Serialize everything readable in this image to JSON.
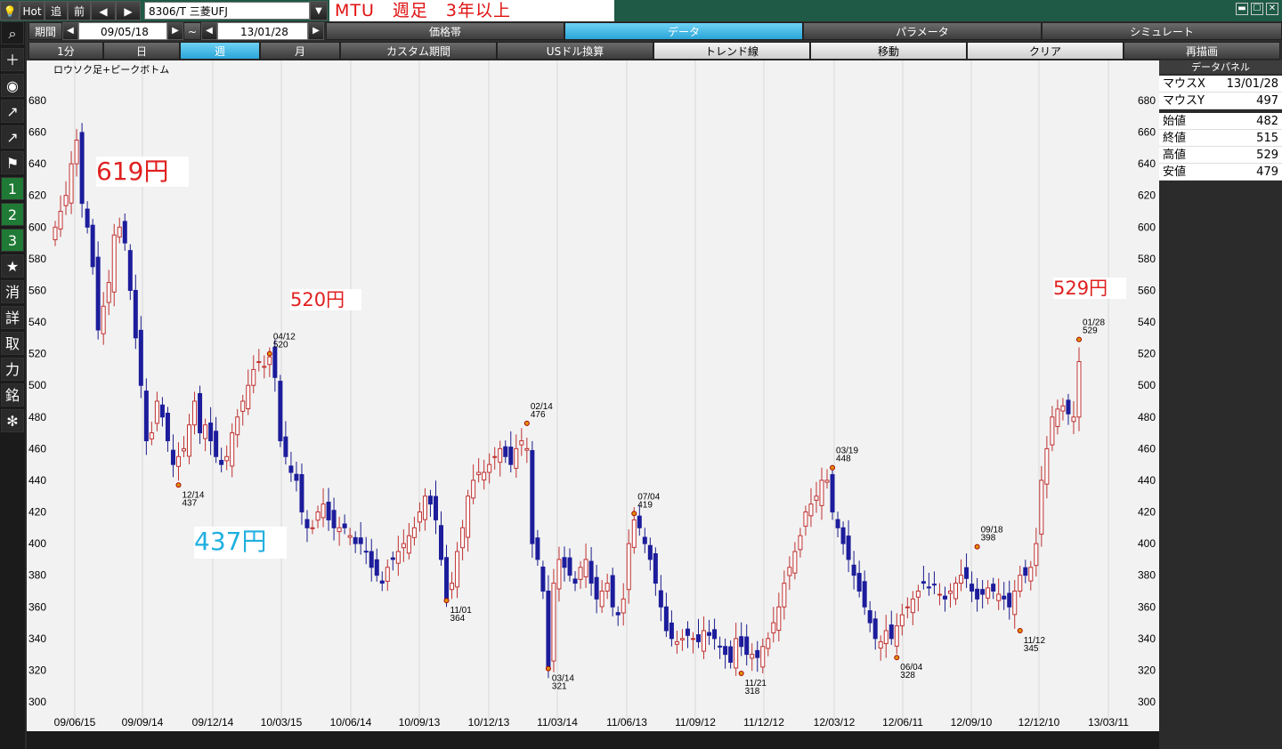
{
  "toolbar": {
    "hot": "Hot",
    "next": "追",
    "prev": "前",
    "arrow_left": "◀",
    "arrow_right": "▶",
    "symbol": "8306/T 三菱UFJ",
    "dropdown": "▼",
    "title": "MTU　週足　3年以上",
    "win_min": "▬",
    "win_max": "☐",
    "win_close": "✕"
  },
  "period": {
    "label": "期間",
    "from": "09/05/18",
    "tilde": "~",
    "to": "13/01/28"
  },
  "tabs_row1": [
    "価格帯",
    "データ",
    "パラメータ",
    "シミュレート"
  ],
  "tabs_row2": [
    "1分",
    "日",
    "週",
    "月",
    "カスタム期間",
    "USドル換算",
    "トレンド線",
    "移動",
    "クリア",
    "再描画"
  ],
  "sidebar": [
    "＋",
    "◉",
    "↗",
    "↗",
    "⚑",
    "1",
    "2",
    "3",
    "★",
    "消",
    "詳",
    "取",
    "力",
    "銘",
    "✻"
  ],
  "chart_name": "ロウソク足+ピークボトム",
  "annotations": [
    {
      "text": "619円",
      "color": "#e02020"
    },
    {
      "text": "520円",
      "color": "#e02020"
    },
    {
      "text": "437円",
      "color": "#20b0e0"
    },
    {
      "text": "529円",
      "color": "#e02020"
    }
  ],
  "panel": {
    "title": "データパネル",
    "rows": [
      {
        "k": "マウスX",
        "v": "13/01/28"
      },
      {
        "k": "マウスY",
        "v": "497"
      },
      {
        "k": "始値",
        "v": "482"
      },
      {
        "k": "終値",
        "v": "515"
      },
      {
        "k": "高値",
        "v": "529"
      },
      {
        "k": "安値",
        "v": "479"
      }
    ]
  },
  "chart_data": {
    "type": "candlestick",
    "ylim": [
      290,
      690
    ],
    "y_ticks": [
      680,
      660,
      640,
      620,
      600,
      580,
      560,
      540,
      520,
      500,
      480,
      460,
      440,
      420,
      400,
      380,
      360,
      340,
      320,
      300
    ],
    "x_labels": [
      "09/06/15",
      "09/09/14",
      "09/12/14",
      "10/03/15",
      "10/06/14",
      "10/09/13",
      "10/12/13",
      "11/03/14",
      "11/06/13",
      "11/09/12",
      "11/12/12",
      "12/03/12",
      "12/06/11",
      "12/09/10",
      "12/12/10",
      "13/03/11"
    ],
    "peaks": [
      {
        "date": "12/14",
        "value": 437,
        "i": 23
      },
      {
        "date": "04/12",
        "value": 520,
        "i": 40
      },
      {
        "date": "11/01",
        "value": 364,
        "i": 73
      },
      {
        "date": "02/14",
        "value": 476,
        "i": 88
      },
      {
        "date": "03/14",
        "value": 321,
        "i": 92
      },
      {
        "date": "07/04",
        "value": 419,
        "i": 108
      },
      {
        "date": "11/21",
        "value": 318,
        "i": 128
      },
      {
        "date": "03/19",
        "value": 448,
        "i": 145
      },
      {
        "date": "06/04",
        "value": 328,
        "i": 157
      },
      {
        "date": "09/18",
        "value": 398,
        "i": 172
      },
      {
        "date": "11/12",
        "value": 345,
        "i": 180
      },
      {
        "date": "01/28",
        "value": 529,
        "i": 191
      }
    ],
    "closes": [
      600,
      610,
      620,
      640,
      655,
      615,
      600,
      575,
      535,
      550,
      565,
      595,
      600,
      590,
      560,
      530,
      500,
      465,
      470,
      490,
      480,
      465,
      450,
      455,
      460,
      475,
      490,
      470,
      475,
      465,
      455,
      450,
      455,
      470,
      480,
      490,
      500,
      510,
      515,
      512,
      518,
      505,
      465,
      455,
      445,
      440,
      420,
      410,
      410,
      420,
      425,
      415,
      410,
      410,
      410,
      405,
      400,
      400,
      395,
      385,
      380,
      375,
      385,
      390,
      395,
      400,
      405,
      410,
      420,
      430,
      425,
      415,
      390,
      365,
      375,
      395,
      410,
      430,
      440,
      445,
      445,
      450,
      455,
      460,
      455,
      450,
      460,
      465,
      460,
      400,
      390,
      370,
      321,
      375,
      390,
      385,
      380,
      375,
      385,
      390,
      375,
      365,
      370,
      375,
      360,
      355,
      365,
      400,
      415,
      410,
      400,
      390,
      375,
      360,
      345,
      340,
      338,
      340,
      342,
      340,
      338,
      345,
      342,
      340,
      335,
      330,
      325,
      340,
      335,
      330,
      330,
      328,
      335,
      340,
      350,
      360,
      375,
      385,
      395,
      405,
      420,
      425,
      430,
      440,
      440,
      420,
      410,
      400,
      390,
      380,
      370,
      360,
      350,
      340,
      338,
      345,
      340,
      348,
      355,
      360,
      365,
      370,
      375,
      372,
      374,
      368,
      365,
      370,
      375,
      380,
      378,
      370,
      365,
      368,
      372,
      370,
      368,
      365,
      360,
      370,
      380,
      380,
      385,
      400,
      440,
      460,
      480,
      485,
      487,
      482,
      480,
      515
    ]
  }
}
